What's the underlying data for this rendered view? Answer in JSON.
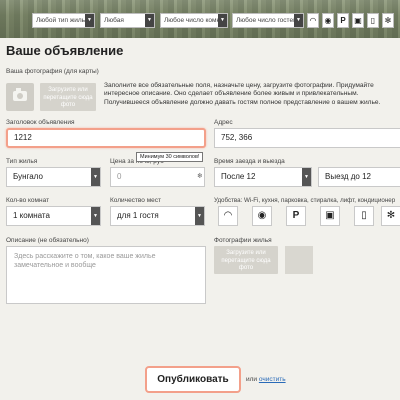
{
  "filters": {
    "housing_type": "Любой тип жилья",
    "any": "Любая",
    "rooms": "Любое число комнат",
    "guests": "Любое число гостей"
  },
  "filter_icons": [
    "wifi-icon",
    "dining-icon",
    "parking-icon",
    "washer-icon",
    "fridge-icon",
    "ac-icon"
  ],
  "page_title": "Ваше объявление",
  "photo": {
    "label": "Ваша фотография (для карты)",
    "upload_text": "Загрузите или перетащите сюда фото"
  },
  "description": "Заполните все обязательные поля, назначьте цену, загрузите фотографии. Придумайте интересное описание. Оно сделает объявление более живым и привлекательным. Получившееся объявление должно давать гостям полное представление о вашем жилье.",
  "listing_title": {
    "label": "Заголовок объявления",
    "value": "1212"
  },
  "address": {
    "label": "Адрес",
    "value": "752, 366"
  },
  "housing_type": {
    "label": "Тип жилья",
    "value": "Бунгало"
  },
  "price": {
    "label": "Цена за ночь, руб",
    "placeholder": "0",
    "tooltip": "Минимум 30 символов!"
  },
  "checkin": {
    "label": "Время заезда и выезда",
    "in_value": "После 12",
    "out_value": "Выезд до 12"
  },
  "rooms": {
    "label": "Кол-во комнат",
    "value": "1 комната"
  },
  "guests": {
    "label": "Количество мест",
    "value": "для 1 гостя"
  },
  "amenities": {
    "label": "Удобства: Wi-Fi, кухня, парковка, стиралка, лифт, кондиционер"
  },
  "listing_description": {
    "label": "Описание (не обязательно)",
    "placeholder": "Здесь расскажите о том, какое ваше жилье замечательное и вообще"
  },
  "housing_photos": {
    "label": "Фотографии жилья",
    "upload_text": "Загрузите или перетащите сюда фото"
  },
  "actions": {
    "publish": "Опубликовать",
    "or": "или",
    "clear": "очистить"
  },
  "colors": {
    "accent": "#f3a08a",
    "link": "#2a6bb8",
    "background": "#f2f1ec"
  }
}
